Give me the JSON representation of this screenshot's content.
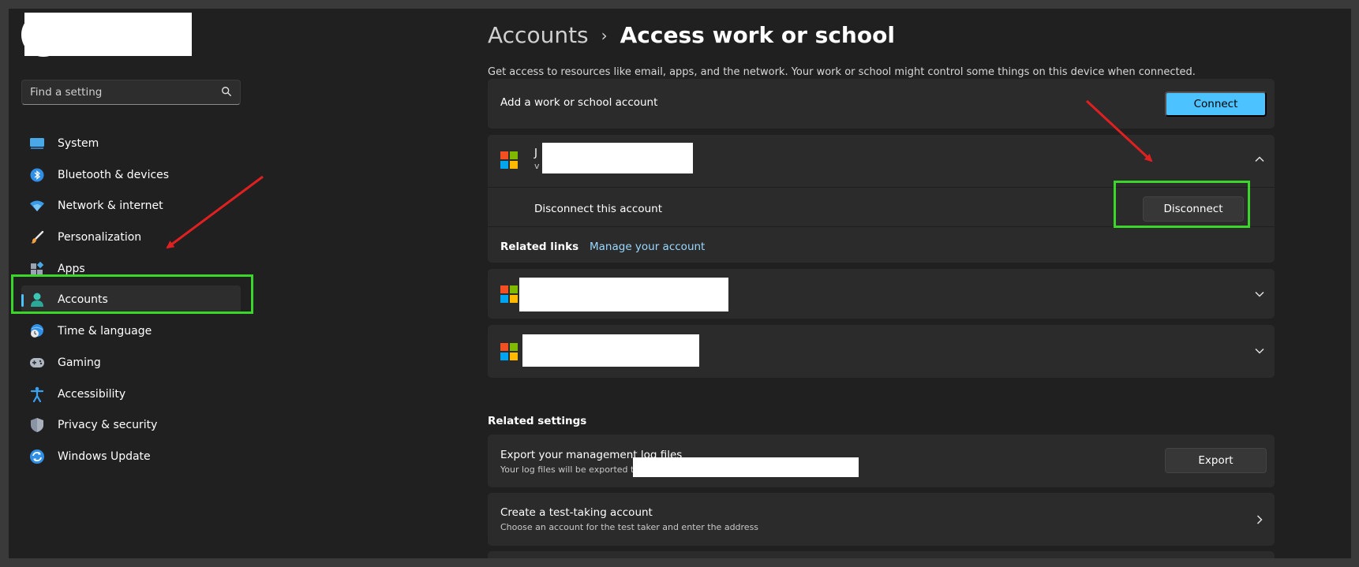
{
  "search": {
    "placeholder": "Find a setting",
    "icon": "search-icon"
  },
  "sidebar": {
    "items": [
      {
        "label": "System",
        "icon": "system-icon"
      },
      {
        "label": "Bluetooth & devices",
        "icon": "bluetooth-icon"
      },
      {
        "label": "Network & internet",
        "icon": "wifi-icon"
      },
      {
        "label": "Personalization",
        "icon": "brush-icon"
      },
      {
        "label": "Apps",
        "icon": "apps-icon"
      },
      {
        "label": "Accounts",
        "icon": "person-icon",
        "active": true
      },
      {
        "label": "Time & language",
        "icon": "globe-clock-icon"
      },
      {
        "label": "Gaming",
        "icon": "gamepad-icon"
      },
      {
        "label": "Accessibility",
        "icon": "accessibility-icon"
      },
      {
        "label": "Privacy & security",
        "icon": "shield-icon"
      },
      {
        "label": "Windows Update",
        "icon": "update-icon"
      }
    ]
  },
  "breadcrumb": {
    "parent": "Accounts",
    "separator": "›",
    "current": "Access work or school"
  },
  "description": "Get access to resources like email, apps, and the network. Your work or school might control some things on this device when connected.",
  "add_account": {
    "label": "Add a work or school account",
    "button": "Connect"
  },
  "account1": {
    "name_initial": "J",
    "email_initial": "v",
    "disconnect_label": "Disconnect this account",
    "disconnect_button": "Disconnect",
    "related_links_label": "Related links",
    "manage_link": "Manage your account"
  },
  "related_settings": {
    "title": "Related settings",
    "export": {
      "title": "Export your management log files",
      "subtitle": "Your log files will be exported t",
      "button": "Export"
    },
    "test_account": {
      "title": "Create a test-taking account",
      "subtitle": "Choose an account for the test taker and enter the address"
    }
  },
  "colors": {
    "accent": "#4cc2ff",
    "highlight": "#3bd62a",
    "annotation_arrow": "#e02020",
    "background": "#202020",
    "card": "#2b2b2b"
  }
}
